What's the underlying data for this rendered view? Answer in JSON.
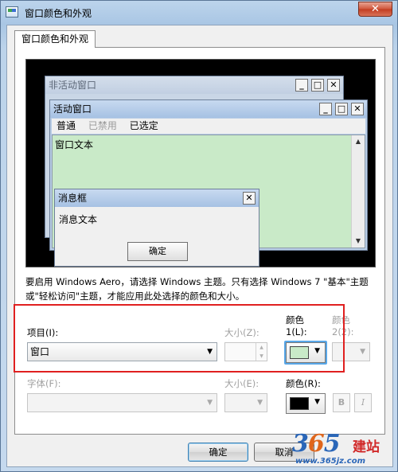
{
  "window": {
    "title": "窗口颜色和外观",
    "close_glyph": "✕"
  },
  "tab": {
    "label": "窗口颜色和外观"
  },
  "preview": {
    "inactive_title": "非活动窗口",
    "active_title": "活动窗口",
    "menu": {
      "normal": "普通",
      "disabled": "已禁用",
      "selected": "已选定"
    },
    "window_text": "窗口文本",
    "message_box": {
      "title": "消息框",
      "text": "消息文本",
      "ok": "确定"
    },
    "controls": {
      "minimize": "_",
      "maximize": "□",
      "close": "✕"
    },
    "window_body_color": "#c9eac8"
  },
  "description": "要启用 Windows Aero，请选择 Windows 主题。只有选择 Windows 7 \"基本\"主题或\"轻松访问\"主题，才能应用此处选择的颜色和大小。",
  "item_row": {
    "item_label": "项目(I):",
    "item_value": "窗口",
    "size_label": "大小(Z):",
    "color1_label_a": "颜色",
    "color1_label_b": "1(L):",
    "color1_value": "#c9eac8",
    "color2_label_a": "颜色",
    "color2_label_b": "2(2):"
  },
  "font_row": {
    "font_label": "字体(F):",
    "size_label": "大小(E):",
    "color_label": "颜色(R):",
    "color_value": "#000000",
    "bold": "B",
    "italic": "I"
  },
  "buttons": {
    "ok": "确定",
    "cancel": "取消"
  },
  "watermark": {
    "logo": "365",
    "cn": "建站",
    "url": "www.365jz.com"
  }
}
